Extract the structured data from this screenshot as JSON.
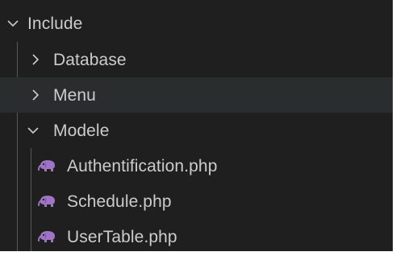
{
  "explorer": {
    "root": {
      "label": "Include",
      "expanded": true,
      "chevron": "chevron-down-icon"
    },
    "folders": [
      {
        "label": "Database",
        "expanded": false,
        "chevron": "chevron-right-icon"
      },
      {
        "label": "Menu",
        "expanded": false,
        "chevron": "chevron-right-icon",
        "hovered": true
      },
      {
        "label": "Modele",
        "expanded": true,
        "chevron": "chevron-down-icon"
      }
    ],
    "files": [
      {
        "label": "Authentification.php",
        "icon": "php-elephant-icon"
      },
      {
        "label": "Schedule.php",
        "icon": "php-elephant-icon"
      },
      {
        "label": "UserTable.php",
        "icon": "php-elephant-icon"
      }
    ]
  },
  "colors": {
    "background": "#1f1f1f",
    "hover_row": "#2a2d2e",
    "text": "#cccccc",
    "indent_guide": "#585858",
    "php_icon": "#a074c4"
  }
}
